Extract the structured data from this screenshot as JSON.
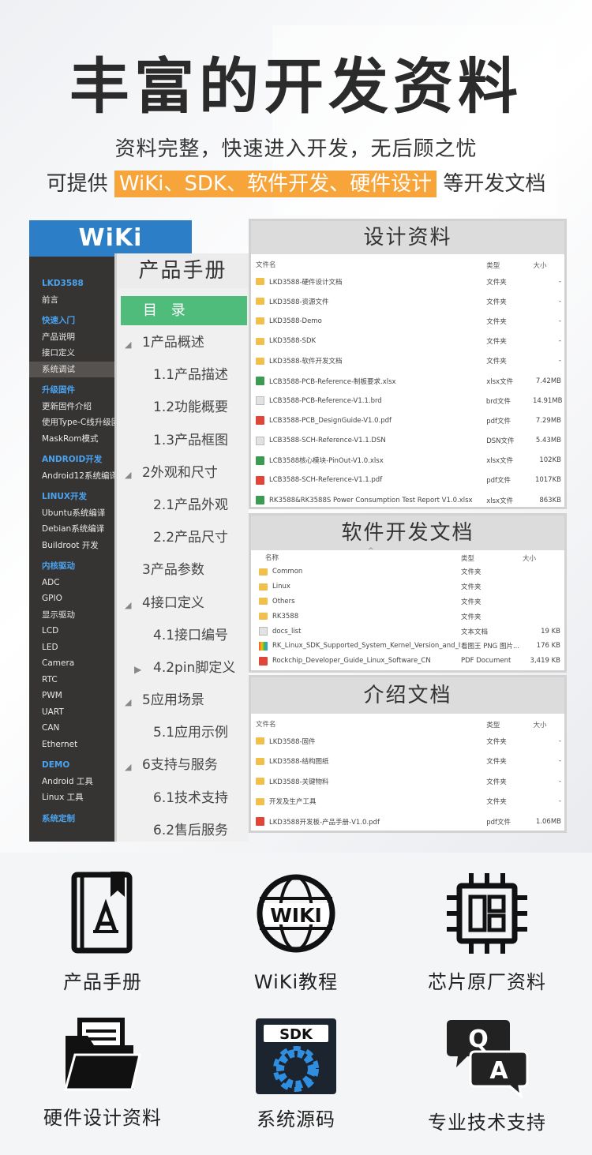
{
  "header": {
    "title": "丰富的开发资料",
    "subtitle_line1": "资料完整，快速进入开发，无后顾之忧",
    "subtitle_line2_prefix": "可提供",
    "subtitle_line2_highlight": "WiKi、SDK、软件开发、硬件设计",
    "subtitle_line2_suffix": "等开发文档"
  },
  "wiki": {
    "title": "WiKi",
    "items": [
      {
        "label": "LKD3588",
        "type": "section"
      },
      {
        "label": "前言",
        "type": "item"
      },
      {
        "label": "快速入门",
        "type": "section"
      },
      {
        "label": "产品说明",
        "type": "item"
      },
      {
        "label": "接口定义",
        "type": "item"
      },
      {
        "label": "系统调试",
        "type": "item",
        "selected": true
      },
      {
        "label": "升级固件",
        "type": "section"
      },
      {
        "label": "更新固件介绍",
        "type": "item"
      },
      {
        "label": "使用Type-C线升级固",
        "type": "item"
      },
      {
        "label": "MaskRom模式",
        "type": "item"
      },
      {
        "label": "ANDROID开发",
        "type": "section"
      },
      {
        "label": "Android12系统编译",
        "type": "item"
      },
      {
        "label": "LINUX开发",
        "type": "section"
      },
      {
        "label": "Ubuntu系统编译",
        "type": "item"
      },
      {
        "label": "Debian系统编译",
        "type": "item"
      },
      {
        "label": "Buildroot 开发",
        "type": "item"
      },
      {
        "label": "内核驱动",
        "type": "section"
      },
      {
        "label": "ADC",
        "type": "item"
      },
      {
        "label": "GPIO",
        "type": "item"
      },
      {
        "label": "显示驱动",
        "type": "item"
      },
      {
        "label": "LCD",
        "type": "item"
      },
      {
        "label": "LED",
        "type": "item"
      },
      {
        "label": "Camera",
        "type": "item"
      },
      {
        "label": "RTC",
        "type": "item"
      },
      {
        "label": "PWM",
        "type": "item"
      },
      {
        "label": "UART",
        "type": "item"
      },
      {
        "label": "CAN",
        "type": "item"
      },
      {
        "label": "Ethernet",
        "type": "item"
      },
      {
        "label": "DEMO",
        "type": "section"
      },
      {
        "label": "Android 工具",
        "type": "item"
      },
      {
        "label": "Linux 工具",
        "type": "item"
      },
      {
        "label": "系统定制",
        "type": "section"
      }
    ]
  },
  "manual": {
    "title": "产品手册",
    "toc_label": "目 录",
    "items": [
      {
        "label": "1产品概述",
        "level": 1,
        "caret": "down"
      },
      {
        "label": "1.1产品描述",
        "level": 2
      },
      {
        "label": "1.2功能概要",
        "level": 2
      },
      {
        "label": "1.3产品框图",
        "level": 2
      },
      {
        "label": "2外观和尺寸",
        "level": 1,
        "caret": "down"
      },
      {
        "label": "2.1产品外观",
        "level": 2
      },
      {
        "label": "2.2产品尺寸",
        "level": 2
      },
      {
        "label": "3产品参数",
        "level": 1
      },
      {
        "label": "4接口定义",
        "level": 1,
        "caret": "down"
      },
      {
        "label": "4.1接口编号",
        "level": 2
      },
      {
        "label": "4.2pin脚定义",
        "level": 2,
        "caret": "right"
      },
      {
        "label": "5应用场景",
        "level": 1,
        "caret": "down"
      },
      {
        "label": "5.1应用示例",
        "level": 2
      },
      {
        "label": "6支持与服务",
        "level": 1,
        "caret": "down"
      },
      {
        "label": "6.1技术支持",
        "level": 2
      },
      {
        "label": "6.2售后服务",
        "level": 2
      }
    ]
  },
  "design_docs": {
    "title": "设计资料",
    "columns": [
      "文件名",
      "类型",
      "大小"
    ],
    "rows": [
      {
        "icon": "folder",
        "name": "LKD3588-硬件设计文档",
        "type": "文件夹",
        "size": "-"
      },
      {
        "icon": "folder",
        "name": "LKD3588-资源文件",
        "type": "文件夹",
        "size": "-"
      },
      {
        "icon": "folder",
        "name": "LKD3588-Demo",
        "type": "文件夹",
        "size": "-"
      },
      {
        "icon": "folder",
        "name": "LKD3588-SDK",
        "type": "文件夹",
        "size": "-"
      },
      {
        "icon": "folder",
        "name": "LKD3588-软件开发文档",
        "type": "文件夹",
        "size": "-"
      },
      {
        "icon": "xlsx",
        "name": "LCB3588-PCB-Reference-制板要求.xlsx",
        "type": "xlsx文件",
        "size": "7.42MB"
      },
      {
        "icon": "blank",
        "name": "LCB3588-PCB-Reference-V1.1.brd",
        "type": "brd文件",
        "size": "14.91MB"
      },
      {
        "icon": "pdf",
        "name": "LCB3588-PCB_DesignGuide-V1.0.pdf",
        "type": "pdf文件",
        "size": "7.29MB"
      },
      {
        "icon": "blank",
        "name": "LCB3588-SCH-Reference-V1.1.DSN",
        "type": "DSN文件",
        "size": "5.43MB"
      },
      {
        "icon": "xlsx",
        "name": "LCB3588核心模块-PinOut-V1.0.xlsx",
        "type": "xlsx文件",
        "size": "102KB"
      },
      {
        "icon": "pdf",
        "name": "LCB3588-SCH-Reference-V1.1.pdf",
        "type": "pdf文件",
        "size": "1017KB"
      },
      {
        "icon": "xlsx",
        "name": "RK3588&RK3588S Power Consumption Test Report V1.0.xlsx",
        "type": "xlsx文件",
        "size": "863KB"
      }
    ]
  },
  "software_docs": {
    "title": "软件开发文档",
    "columns": [
      "名称",
      "类型",
      "大小"
    ],
    "sort_glyph": "^",
    "rows": [
      {
        "icon": "folder",
        "name": "Common",
        "type": "文件夹",
        "size": ""
      },
      {
        "icon": "folder",
        "name": "Linux",
        "type": "文件夹",
        "size": ""
      },
      {
        "icon": "folder",
        "name": "Others",
        "type": "文件夹",
        "size": ""
      },
      {
        "icon": "folder",
        "name": "RK3588",
        "type": "文件夹",
        "size": ""
      },
      {
        "icon": "blank",
        "name": "docs_list",
        "type": "文本文档",
        "size": "19 KB"
      },
      {
        "icon": "png",
        "name": "RK_Linux_SDK_Supported_System_Kernel_Version_and_ISP_Version_List",
        "type": "看图王 PNG 图片...",
        "size": "176 KB"
      },
      {
        "icon": "pdf",
        "name": "Rockchip_Developer_Guide_Linux_Software_CN",
        "type": "PDF Document",
        "size": "3,419 KB"
      }
    ]
  },
  "intro_docs": {
    "title": "介绍文档",
    "columns": [
      "文件名",
      "类型",
      "大小"
    ],
    "rows": [
      {
        "icon": "folder",
        "name": "LKD3588-固件",
        "type": "文件夹",
        "size": "-"
      },
      {
        "icon": "folder",
        "name": "LKD3588-结构图纸",
        "type": "文件夹",
        "size": "-"
      },
      {
        "icon": "folder",
        "name": "LKD3588-关键物料",
        "type": "文件夹",
        "size": "-"
      },
      {
        "icon": "folder",
        "name": "开发及生产工具",
        "type": "文件夹",
        "size": "-"
      },
      {
        "icon": "pdf",
        "name": "LKD3588开发板-产品手册-V1.0.pdf",
        "type": "pdf文件",
        "size": "1.06MB"
      }
    ]
  },
  "features": [
    {
      "icon": "manual-book-icon",
      "label": "产品手册"
    },
    {
      "icon": "wiki-globe-icon",
      "label": "WiKi教程",
      "badge": "WIKI"
    },
    {
      "icon": "chip-icon",
      "label": "芯片原厂资料"
    },
    {
      "icon": "folder-docs-icon",
      "label": "硬件设计资料"
    },
    {
      "icon": "sdk-gear-icon",
      "label": "系统源码",
      "badge": "SDK"
    },
    {
      "icon": "qa-chat-icon",
      "label": "专业技术支持",
      "badge_q": "Q",
      "badge_a": "A"
    }
  ],
  "colors": {
    "accent_blue": "#2c7fc7",
    "highlight_orange": "#f7a43a",
    "toc_green": "#4fbc7b",
    "sidebar_dark": "#363433"
  }
}
